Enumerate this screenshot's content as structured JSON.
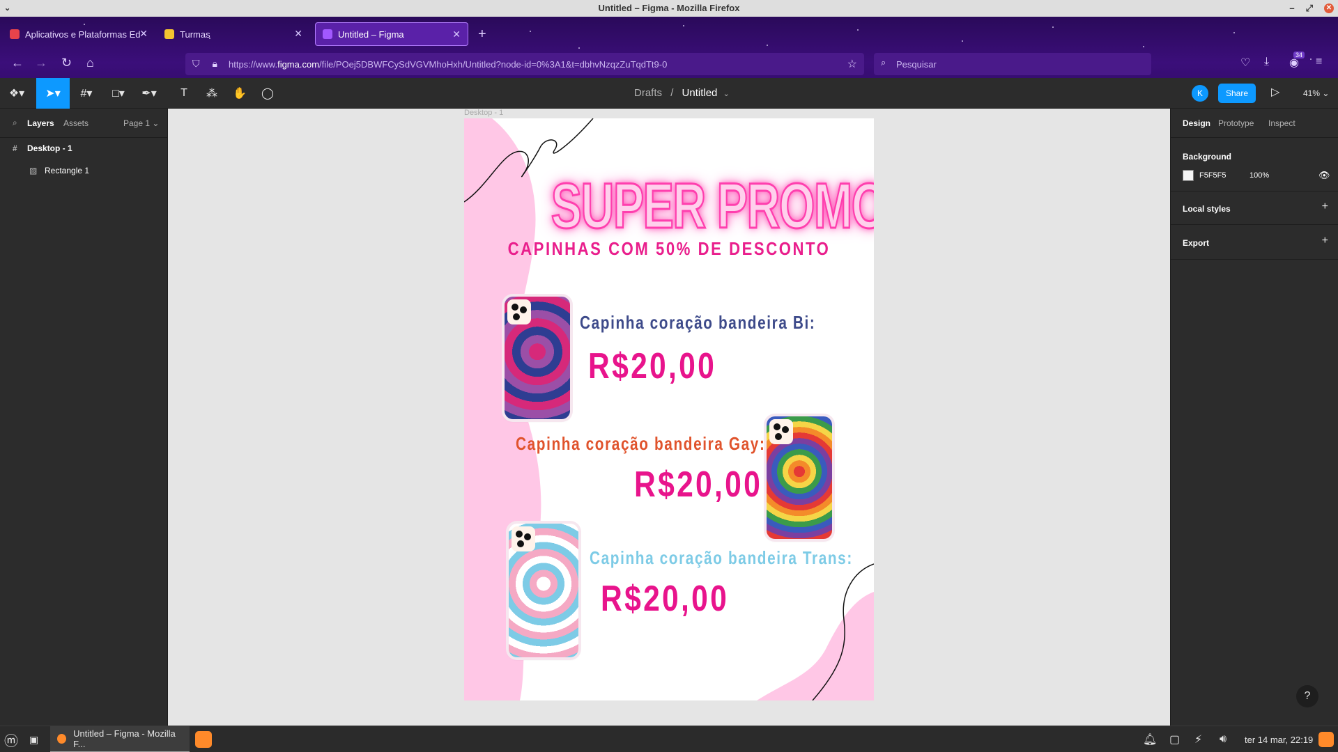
{
  "window": {
    "title": "Untitled – Figma - Mozilla Firefox"
  },
  "browser": {
    "tabs": [
      {
        "label": "Aplicativos e Plataformas Ed",
        "favicon_color": "#e7434b"
      },
      {
        "label": "Turmas",
        "favicon_color": "#f4c430"
      },
      {
        "label": "Untitled – Figma",
        "favicon_color": "#a259ff",
        "active": true
      }
    ],
    "url_prefix": "https://www.",
    "url_domain": "figma.com",
    "url_rest": "/file/POej5DBWFCySdVGVMhoHxh/Untitled?node-id=0%3A1&t=dbhvNzqzZuTqdTt9-0",
    "search_placeholder": "Pesquisar",
    "downloads_badge": "34"
  },
  "figma": {
    "breadcrumb": {
      "parent": "Drafts",
      "separator": "/",
      "current": "Untitled"
    },
    "avatar_initial": "K",
    "share_label": "Share",
    "zoom": "41%",
    "left_panel": {
      "tabs": [
        "Layers",
        "Assets"
      ],
      "page": "Page 1",
      "layers": [
        {
          "name": "Desktop - 1",
          "icon": "frame-icon"
        },
        {
          "name": "Rectangle 1",
          "icon": "image-icon"
        }
      ]
    },
    "right_panel": {
      "tabs": [
        "Design",
        "Prototype",
        "Inspect"
      ],
      "background_title": "Background",
      "background_hex": "F5F5F5",
      "background_opacity": "100%",
      "local_styles": "Local styles",
      "export": "Export"
    },
    "frame_label": "Desktop - 1"
  },
  "poster": {
    "title": "SUPER PROMOÇÃO!!",
    "subtitle": "CAPINHAS COM 50% DE DESCONTO",
    "items": [
      {
        "label": "Capinha coração bandeira Bi:",
        "price": "R$20,00",
        "label_color": "#3d4a8a"
      },
      {
        "label": "Capinha coração bandeira Gay:",
        "price": "R$20,00",
        "label_color": "#e0532c"
      },
      {
        "label": "Capinha coração bandeira Trans:",
        "price": "R$20,00",
        "label_color": "#7dcbe6"
      }
    ],
    "colors": {
      "pink_blob": "#ffc7e6",
      "price": "#e8148c"
    }
  },
  "taskbar": {
    "window_label": "Untitled – Figma - Mozilla F...",
    "clock": "ter 14 mar, 22:19"
  }
}
